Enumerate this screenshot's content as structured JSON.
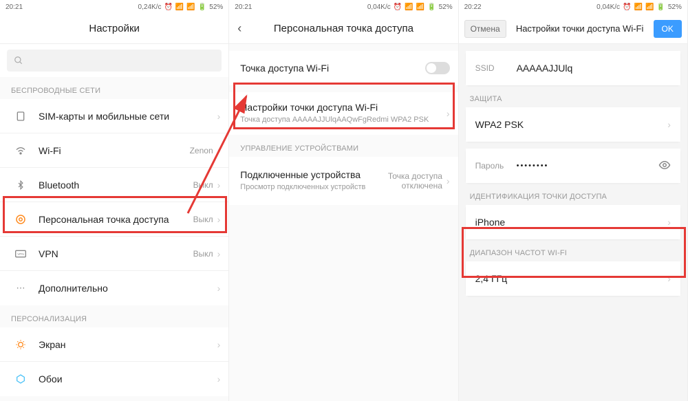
{
  "status": {
    "time1": "20:21",
    "time2": "20:21",
    "time3": "20:22",
    "speed1": "0,24K/c",
    "speed2": "0,04K/c",
    "speed3": "0,04K/c",
    "battery": "52%"
  },
  "panel1": {
    "title": "Настройки",
    "section_wireless": "БЕСПРОВОДНЫЕ СЕТИ",
    "items": {
      "sim": "SIM-карты и мобильные сети",
      "wifi": "Wi-Fi",
      "wifi_value": "Zenon",
      "bluetooth": "Bluetooth",
      "bluetooth_value": "Выкл",
      "hotspot": "Персональная точка доступа",
      "hotspot_value": "Выкл",
      "vpn": "VPN",
      "vpn_value": "Выкл",
      "more": "Дополнительно"
    },
    "section_personal": "ПЕРСОНАЛИЗАЦИЯ",
    "items2": {
      "display": "Экран",
      "wallpaper": "Обои"
    }
  },
  "panel2": {
    "title": "Персональная точка доступа",
    "items": {
      "hotspot": "Точка доступа Wi-Fi",
      "settings": "Настройки точки доступа Wi-Fi",
      "settings_sub": "Точка доступа AAAAAJJUlqAAQwFgRedmi WPA2 PSK"
    },
    "section_devices": "УПРАВЛЕНИЕ УСТРОЙСТВАМИ",
    "items2": {
      "connected": "Подключенные устройства",
      "connected_sub": "Просмотр подключенных устройств",
      "connected_value": "Точка доступа отключена"
    }
  },
  "panel3": {
    "cancel": "Отмена",
    "title": "Настройки точки доступа Wi-Fi",
    "ok": "OK",
    "ssid_label": "SSID",
    "ssid_value": "AAAAAJJUlq",
    "section_security": "ЗАЩИТА",
    "security_value": "WPA2 PSK",
    "password_label": "Пароль",
    "password_value": "••••••••",
    "section_id": "ИДЕНТИФИКАЦИЯ ТОЧКИ ДОСТУПА",
    "id_value": "iPhone",
    "section_band": "ДИАПАЗОН ЧАСТОТ WI-FI",
    "band_value": "2,4 ГГц"
  }
}
